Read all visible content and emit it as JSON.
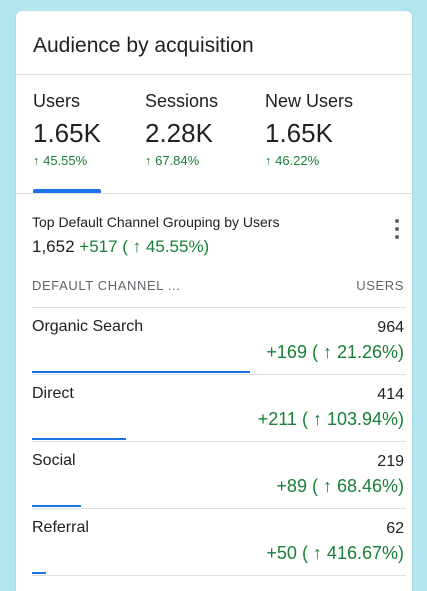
{
  "card": {
    "title": "Audience by acquisition"
  },
  "metrics": [
    {
      "label": "Users",
      "value": "1.65K",
      "change": "↑ 45.55%"
    },
    {
      "label": "Sessions",
      "value": "2.28K",
      "change": "↑ 67.84%"
    },
    {
      "label": "New Users",
      "value": "1.65K",
      "change": "↑ 46.22%"
    }
  ],
  "selected_metric": "Users",
  "breakdown": {
    "title": "Top Default Channel Grouping by Users",
    "total": "1,652",
    "delta": "+517 ( ↑ 45.55%)",
    "more_icon": "more-vert-icon"
  },
  "table": {
    "col_left": "DEFAULT CHANNEL ...",
    "col_right": "USERS",
    "rows": [
      {
        "channel": "Organic Search",
        "users": "964",
        "change": "+169 ( ↑ 21.26%)",
        "share": 1.0
      },
      {
        "channel": "Direct",
        "users": "414",
        "change": "+211 ( ↑ 103.94%)",
        "share": 0.429
      },
      {
        "channel": "Social",
        "users": "219",
        "change": "+89 ( ↑ 68.46%)",
        "share": 0.227
      },
      {
        "channel": "Referral",
        "users": "62",
        "change": "+50 ( ↑ 416.67%)",
        "share": 0.064
      }
    ]
  },
  "colors": {
    "background": "#b3e5ef",
    "accent": "#1a73e8",
    "positive": "#188038",
    "text": "#202124",
    "muted": "#5f6368"
  }
}
